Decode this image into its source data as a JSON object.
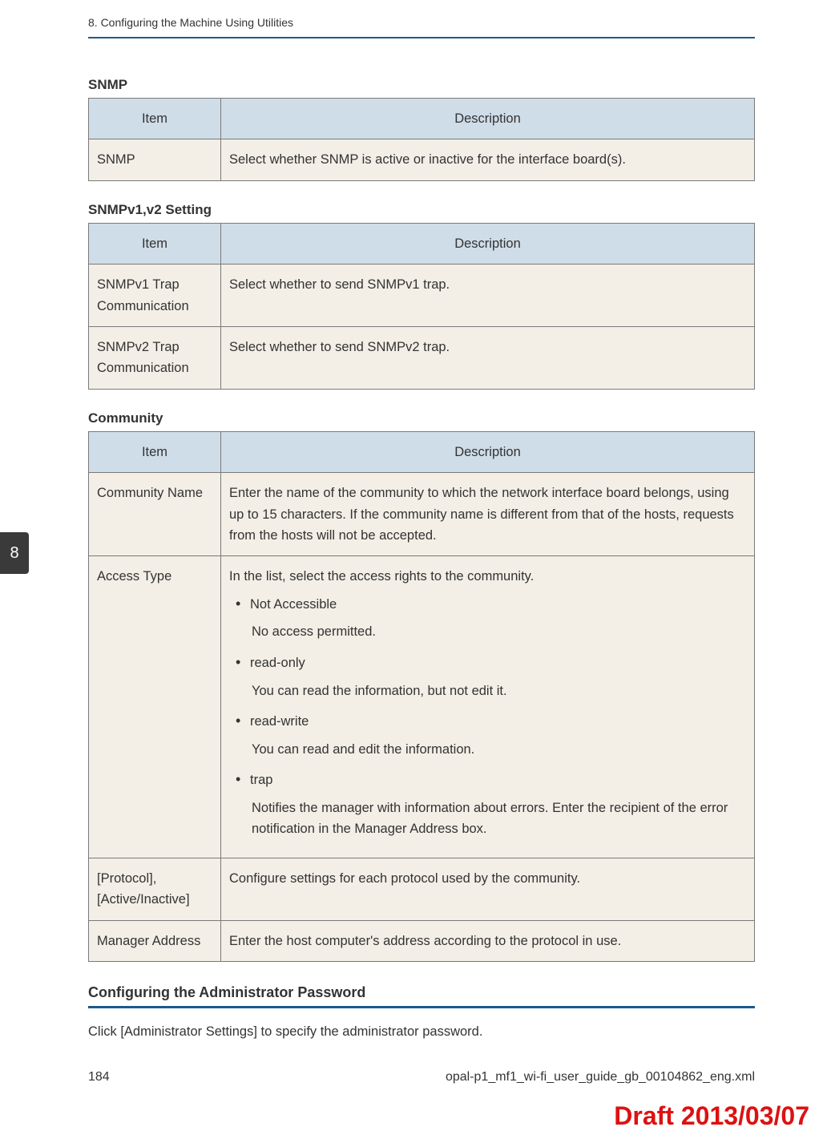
{
  "header": {
    "chapter": "8. Configuring the Machine Using Utilities"
  },
  "sideTab": "8",
  "sections": [
    {
      "title": "SNMP",
      "headers": {
        "item": "Item",
        "desc": "Description"
      },
      "rows": [
        {
          "item": "SNMP",
          "desc": "Select whether SNMP is active or inactive for the interface board(s)."
        }
      ]
    },
    {
      "title": "SNMPv1,v2 Setting",
      "headers": {
        "item": "Item",
        "desc": "Description"
      },
      "rows": [
        {
          "item": "SNMPv1 Trap Communication",
          "desc": "Select whether to send SNMPv1 trap."
        },
        {
          "item": "SNMPv2 Trap Communication",
          "desc": "Select whether to send SNMPv2 trap."
        }
      ]
    },
    {
      "title": "Community",
      "headers": {
        "item": "Item",
        "desc": "Description"
      },
      "rows": [
        {
          "item": "Community Name",
          "desc": "Enter the name of the community to which the network interface board belongs, using up to 15 characters. If the community name is different from that of the hosts, requests from the hosts will not be accepted."
        },
        {
          "item": "Access Type",
          "desc_intro": "In the list, select the access rights to the community.",
          "bullets": [
            {
              "head": "Not Accessible",
              "sub": "No access permitted."
            },
            {
              "head": "read-only",
              "sub": "You can read the information, but not edit it."
            },
            {
              "head": "read-write",
              "sub": "You can read and edit the information."
            },
            {
              "head": "trap",
              "sub": "Notifies the manager with information about errors. Enter the recipient of the error notification in the Manager Address box."
            }
          ]
        },
        {
          "item": "[Protocol], [Active/Inactive]",
          "desc": "Configure settings for each protocol used by the community."
        },
        {
          "item": "Manager Address",
          "desc": "Enter the host computer's address according to the protocol in use."
        }
      ]
    }
  ],
  "subsection": {
    "title": "Configuring the Administrator Password",
    "body": "Click [Administrator Settings] to specify the administrator password."
  },
  "footer": {
    "pageNum": "184",
    "docId": "opal-p1_mf1_wi-fi_user_guide_gb_00104862_eng.xml"
  },
  "draft": "Draft 2013/03/07"
}
